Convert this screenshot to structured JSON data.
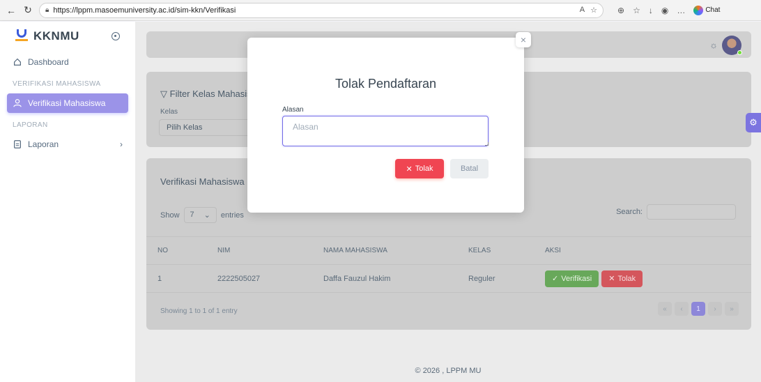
{
  "browser": {
    "url": "https://lppm.masoemuniversity.ac.id/sim-kkn/Verifikasi",
    "chat_label": "Chat"
  },
  "sidebar": {
    "brand": "KKNMU",
    "items": [
      {
        "label": "Dashboard"
      },
      {
        "header": "VERIFIKASI MAHASISWA"
      },
      {
        "label": "Verifikasi Mahasiswa"
      },
      {
        "header": "LAPORAN"
      },
      {
        "label": "Laporan"
      }
    ]
  },
  "filter": {
    "title": "Filter Kelas Mahasiswa",
    "kelas_label": "Kelas",
    "kelas_value": "Pilih Kelas"
  },
  "table_card": {
    "title": "Verifikasi Mahasiswa",
    "show_label": "Show",
    "show_value": "7",
    "entries_label": "entries",
    "search_label": "Search:",
    "headers": [
      "NO",
      "NIM",
      "NAMA MAHASISWA",
      "KELAS",
      "AKSI"
    ],
    "rows": [
      {
        "no": "1",
        "nim": "2222505027",
        "nama": "Daffa Fauzul Hakim",
        "kelas": "Reguler"
      }
    ],
    "verif_label": "Verifikasi",
    "tolak_label": "Tolak",
    "showing": "Showing 1 to 1 of 1 entry",
    "pager": [
      "«",
      "‹",
      "1",
      "›",
      "»"
    ]
  },
  "footer": "© 2026 , LPPM MU",
  "modal": {
    "title": "Tolak Pendaftaran",
    "alasan_label": "Alasan",
    "alasan_placeholder": "Alasan",
    "tolak_label": "Tolak",
    "batal_label": "Batal"
  },
  "colors": {
    "accent": "#696cff",
    "danger": "#f04552",
    "success": "#68a85a"
  }
}
